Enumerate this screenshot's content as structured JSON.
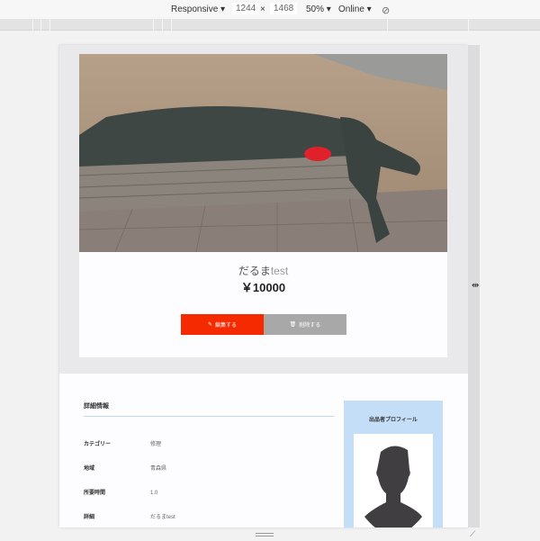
{
  "devtools": {
    "device": "Responsive ▾",
    "width": "1244",
    "x": "×",
    "height": "1468",
    "zoom": "50% ▾",
    "network": "Online ▾"
  },
  "item": {
    "title": "だるま",
    "title_suffix": "test",
    "price": "￥10000"
  },
  "buttons": {
    "edit": "編集する",
    "delete": "削除する"
  },
  "details": {
    "heading": "詳細情報",
    "rows": [
      {
        "label": "カテゴリー",
        "value": "修理"
      },
      {
        "label": "地域",
        "value": "青森県"
      },
      {
        "label": "所要時間",
        "value": "1.0"
      },
      {
        "label": "詳細",
        "value": "だるまtest"
      }
    ]
  },
  "profile": {
    "heading": "出品者プロフィール"
  }
}
